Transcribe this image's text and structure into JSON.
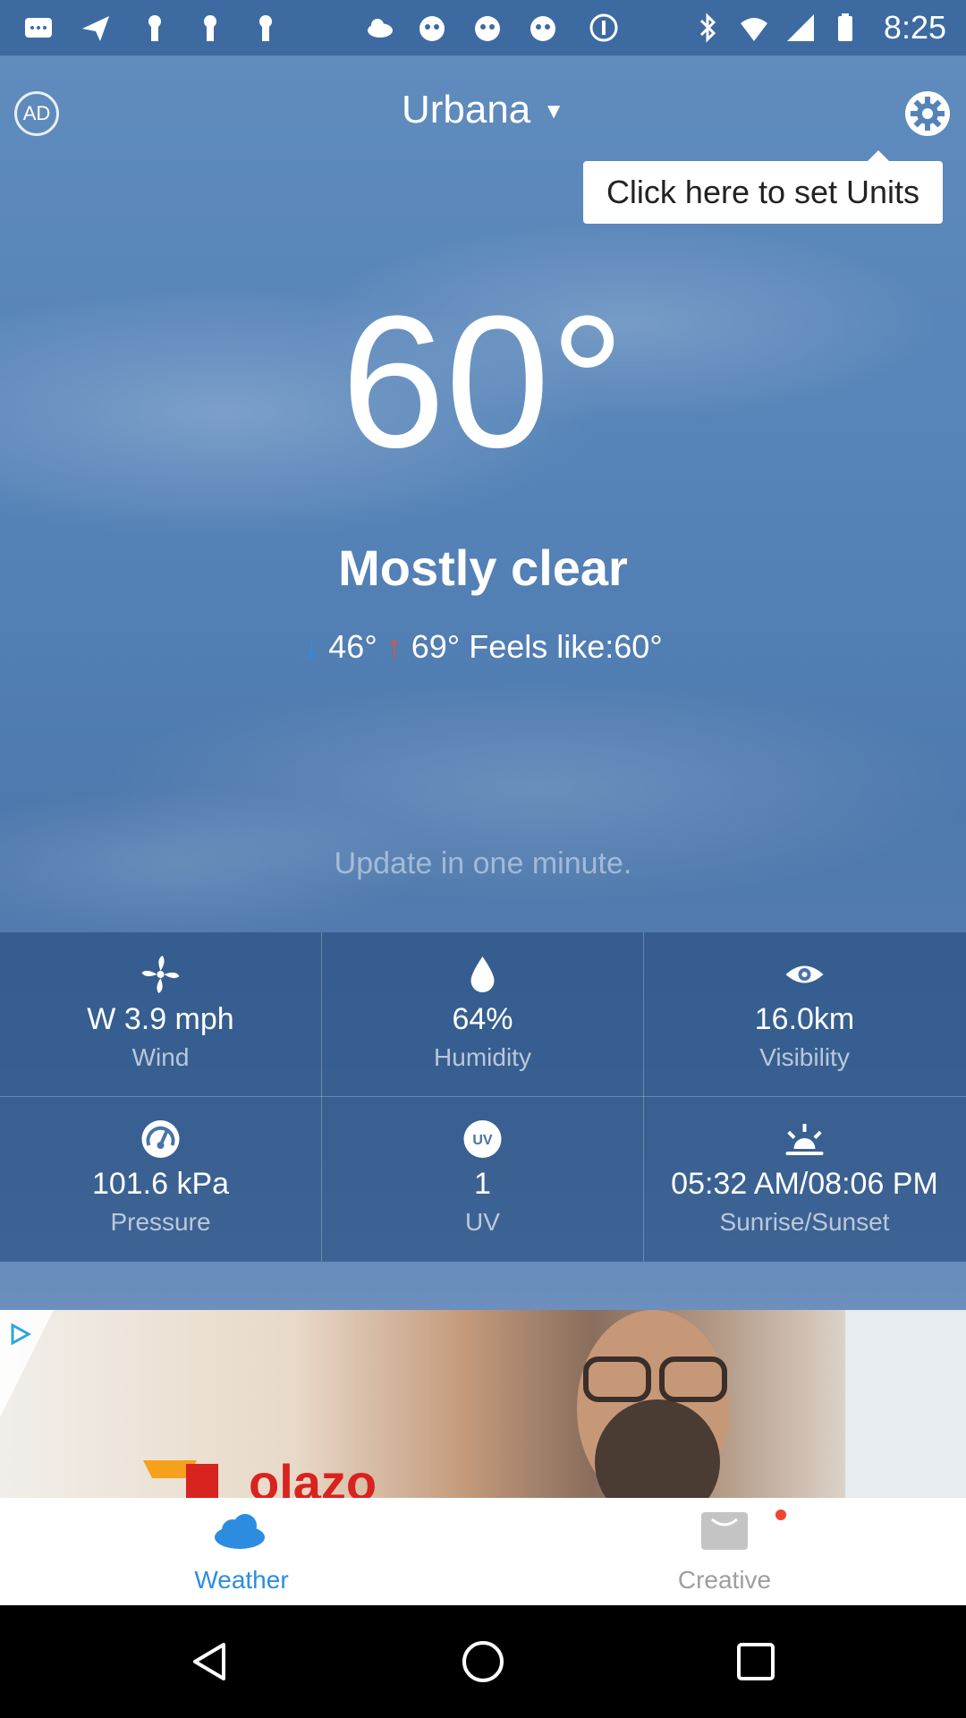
{
  "status_bar": {
    "time": "8:25"
  },
  "header": {
    "ad_label": "AD",
    "city": "Urbana",
    "tooltip": "Click here to set Units"
  },
  "current": {
    "temperature": "60°",
    "condition": "Mostly clear",
    "low": "46°",
    "high": "69°",
    "feels_like": "Feels like:60°",
    "update_text": "Update in one minute."
  },
  "details": [
    {
      "icon": "fan-icon",
      "value": "W  3.9 mph",
      "label": "Wind"
    },
    {
      "icon": "water-drop-icon",
      "value": "64%",
      "label": "Humidity"
    },
    {
      "icon": "eye-icon",
      "value": "16.0km",
      "label": "Visibility"
    },
    {
      "icon": "gauge-icon",
      "value": "101.6 kPa",
      "label": "Pressure"
    },
    {
      "icon": "uv-icon",
      "value": "1",
      "label": "UV"
    },
    {
      "icon": "sunrise-icon",
      "value": "05:32 AM/08:06 PM",
      "label": "Sunrise/Sunset"
    }
  ],
  "ad": {
    "brand_text": "olazo"
  },
  "tabs": [
    {
      "label": "Weather",
      "active": true
    },
    {
      "label": "Creative",
      "active": false
    }
  ],
  "colors": {
    "accent": "#2c8de0",
    "low_arrow": "#2c8de0",
    "high_arrow": "#e6503b",
    "tab_inactive": "#9e9e9e"
  }
}
